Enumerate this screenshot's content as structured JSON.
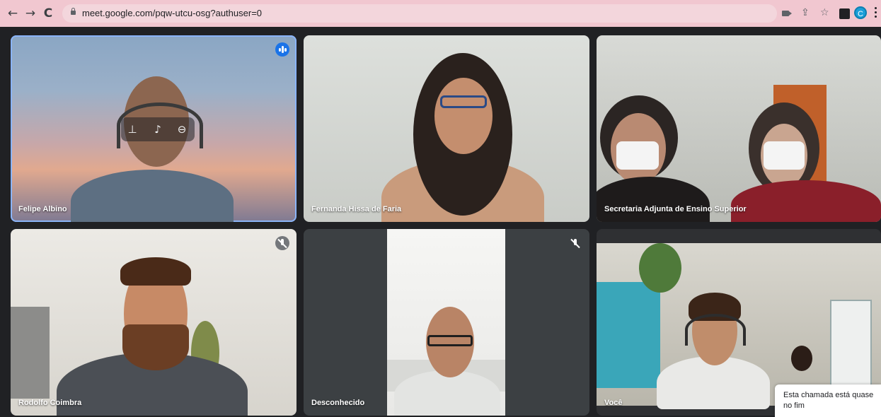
{
  "browser": {
    "back_icon": "arrow-left-icon",
    "forward_icon": "arrow-right-icon",
    "reload_icon": "reload-icon",
    "url": "meet.google.com/pqw-utcu-osg?authuser=0",
    "profile_initial": "C",
    "bar_color": "#f1c7d0"
  },
  "meeting": {
    "participants": [
      {
        "name": "Felipe Albino",
        "status": "speaking",
        "status_icon": "audio-level-icon"
      },
      {
        "name": "Fernanda Hissa de Faria"
      },
      {
        "name": "Secretaria Adjunta de Ensino Superior"
      },
      {
        "name": "Rodolfo Coimbra",
        "status": "muted",
        "status_icon": "mic-off-icon"
      },
      {
        "name": "Desconhecido",
        "status": "muted",
        "status_icon": "mic-off-icon"
      },
      {
        "name": "Você"
      }
    ],
    "hover_controls": [
      "pin-icon",
      "mic-icon",
      "remove-icon"
    ],
    "active_speaker_color": "#8ab4f8"
  },
  "toast": {
    "message": "Esta chamada está quase no fim"
  }
}
